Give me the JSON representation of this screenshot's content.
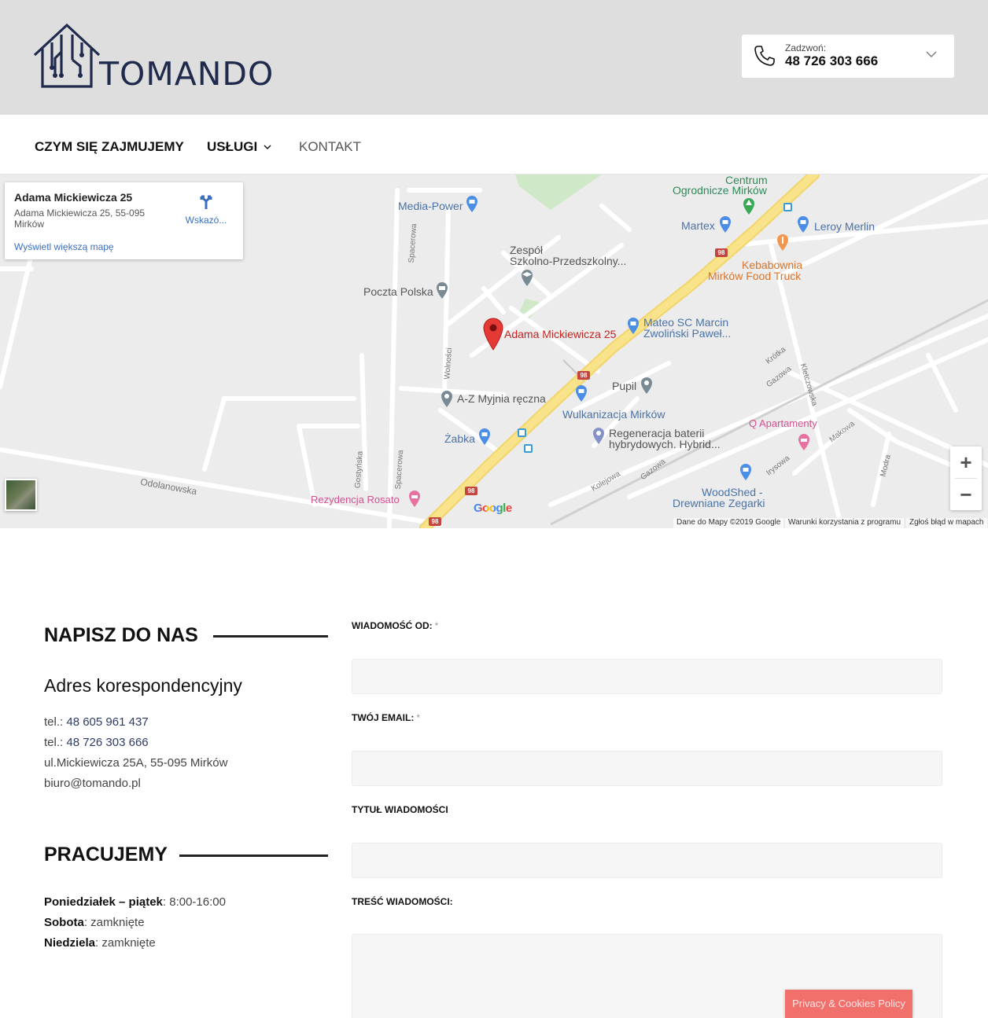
{
  "header": {
    "logo_text": "TOMANDO",
    "call_label": "Zadzwoń:",
    "call_number": "48 726 303 666"
  },
  "nav": {
    "items": [
      {
        "label": "CZYM SIĘ ZAJMUJEMY"
      },
      {
        "label": "USŁUGI"
      },
      {
        "label": "KONTAKT"
      }
    ]
  },
  "map": {
    "card": {
      "title": "Adama Mickiewicza 25",
      "address": "Adama Mickiewicza 25, 55-095 Mirków",
      "directions": "Wskazó...",
      "larger_map": "Wyświetl większą mapę"
    },
    "marker_label": "Adama Mickiewicza 25",
    "pois": {
      "centrum": "Centrum",
      "ogrodnicze": "Ogrodnicze Mirków",
      "media_power": "Media-Power",
      "martex": "Martex",
      "leroy": "Leroy Merlin",
      "zespol1": "Zespół",
      "zespol2": "Szkolno-Przedszkolny...",
      "kebab1": "Kebabownia",
      "kebab2": "Mirków Food Truck",
      "poczta": "Poczta Polska",
      "mateo1": "Mateo SC Marcin",
      "mateo2": "Zwoliński Paweł...",
      "pupil": "Pupil",
      "myjnia": "A-Z Myjnia ręczna",
      "wulkanizacja": "Wulkanizacja Mirków",
      "zabka": "Żabka",
      "regeneracja1": "Regeneracja baterii",
      "regeneracja2": "hybrydowych. Hybrid...",
      "apartamenty": "Q Apartamenty",
      "woodshed1": "WoodShed -",
      "woodshed2": "Drewniane Zegarki",
      "rezydencja": "Rezydencja Rosato"
    },
    "streets": {
      "odolanowska": "Odolanowska",
      "spacerowa": "Spacerowa",
      "wolnosci": "Wolności",
      "gostynska": "Gostyńska",
      "krotka": "Krótka",
      "gazowa": "Gazowa",
      "kletczowska": "Kletczowska",
      "makowa": "Makowa",
      "irysowa": "Irysowa",
      "kolejowa": "Kolejowa",
      "modra": "Modra"
    },
    "highway": "98",
    "google": "Google",
    "footer": {
      "data": "Dane do Mapy ©2019 Google",
      "terms": "Warunki korzystania z programu",
      "report": "Zgłoś błąd w mapach"
    },
    "zoom_in": "+",
    "zoom_out": "−"
  },
  "contact": {
    "section_title": "NAPISZ DO NAS",
    "subtitle": "Adres korespondencyjny",
    "tel_prefix": "tel.:",
    "tel1": "48 605 961 437",
    "tel2": "48 726 303 666",
    "address": "ul.Mickiewicza 25A, 55-095 Mirków",
    "email": "biuro@tomando.pl"
  },
  "hours": {
    "section_title": "PRACUJEMY",
    "rows": [
      {
        "day": "Poniedziałek – piątek",
        "value": ": 8:00-16:00"
      },
      {
        "day": "Sobota",
        "value": ": zamknięte"
      },
      {
        "day": "Niedziela",
        "value": ": zamknięte"
      }
    ]
  },
  "form": {
    "from_label": "WIADOMOŚĆ OD:",
    "email_label": "TWÓJ EMAIL:",
    "subject_label": "TYTUŁ WIADOMOŚCI",
    "body_label": "TREŚĆ WIADOMOŚCI:",
    "required_mark": "*"
  },
  "privacy": "Privacy & Cookies Policy",
  "colors": {
    "header_bg": "#dedede",
    "brand": "#1f2a4d",
    "map_road_major": "#f8e28a",
    "privacy_bg": "#f2706c"
  }
}
